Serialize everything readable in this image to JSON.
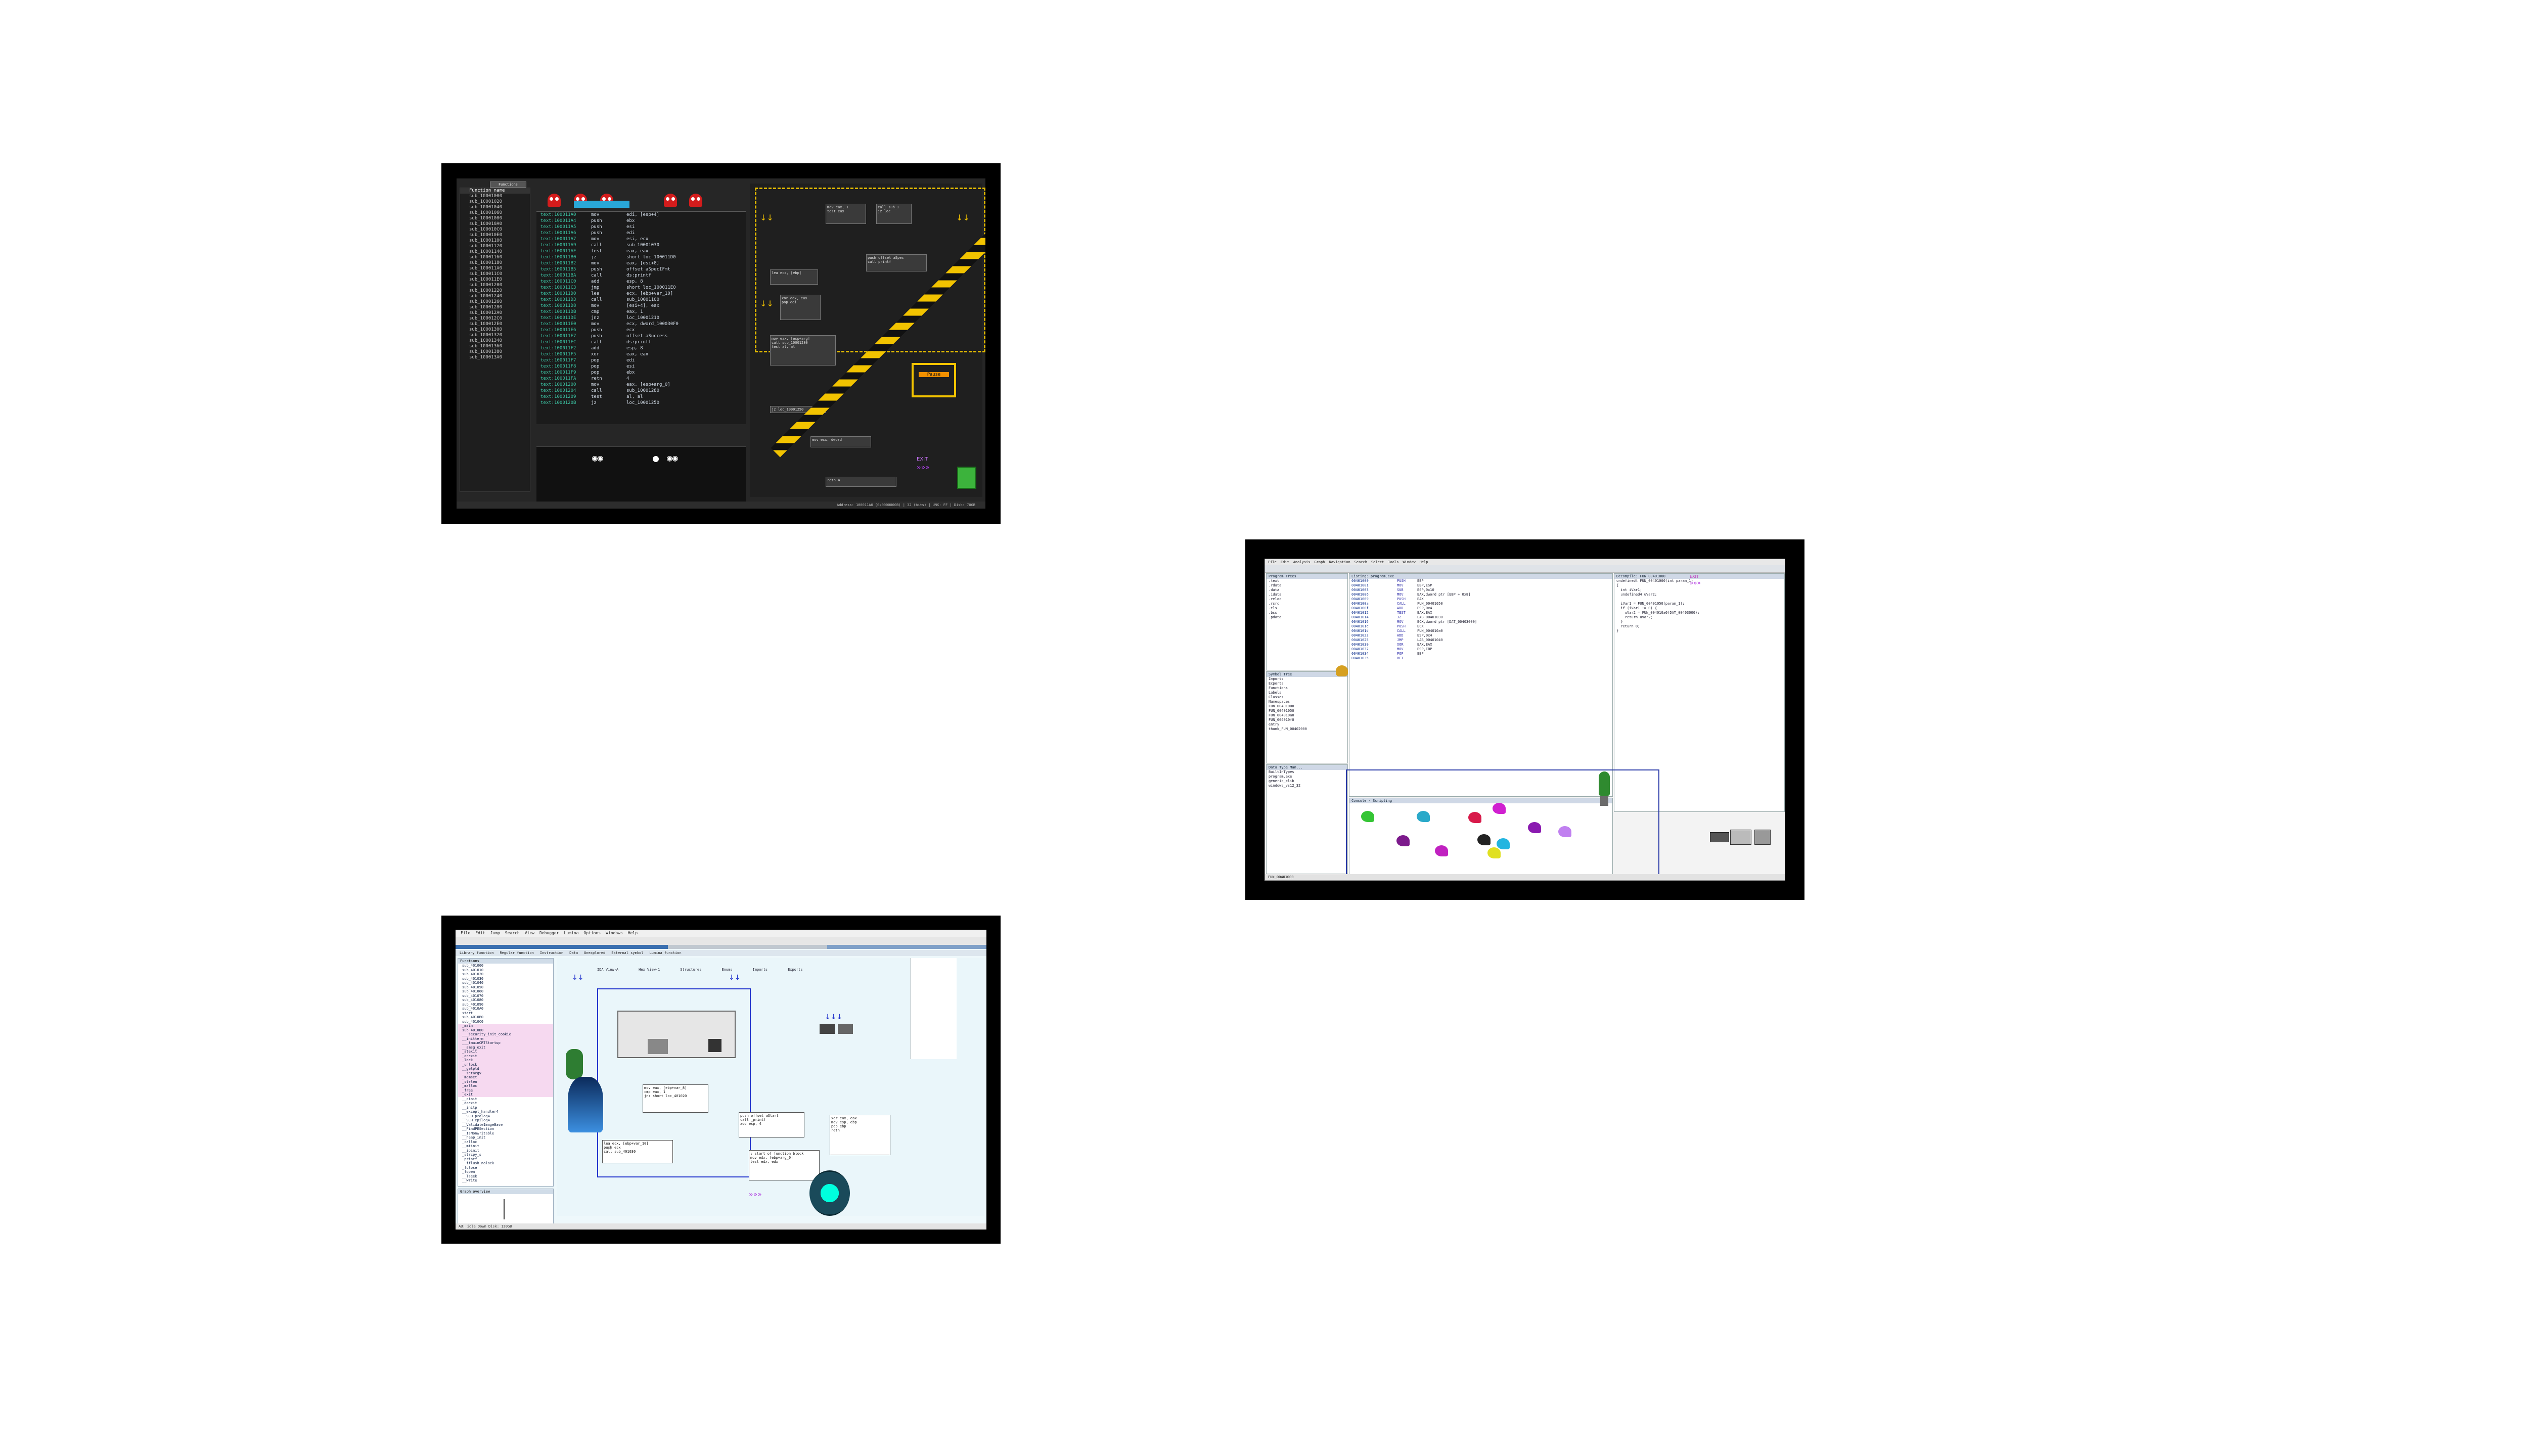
{
  "screens": [
    {
      "theme": "dark",
      "window_tab": "Functions",
      "functions_header": "Function name",
      "functions": [
        "sub_10001000",
        "sub_10001020",
        "sub_10001040",
        "sub_10001060",
        "sub_10001080",
        "sub_100010A0",
        "sub_100010C0",
        "sub_100010E0",
        "sub_10001100",
        "sub_10001120",
        "sub_10001140",
        "sub_10001160",
        "sub_10001180",
        "sub_100011A0",
        "sub_100011C0",
        "sub_100011E0",
        "sub_10001200",
        "sub_10001220",
        "sub_10001240",
        "sub_10001260",
        "sub_10001280",
        "sub_100012A0",
        "sub_100012C0",
        "sub_100012E0",
        "sub_10001300",
        "sub_10001320",
        "sub_10001340",
        "sub_10001360",
        "sub_10001380",
        "sub_100013A0"
      ],
      "code_lines": [
        {
          "addr": "text:100011A0",
          "mn": "mov",
          "op": "edi, [esp+4]"
        },
        {
          "addr": "text:100011A4",
          "mn": "push",
          "op": "ebx"
        },
        {
          "addr": "text:100011A5",
          "mn": "push",
          "op": "esi"
        },
        {
          "addr": "text:100011A6",
          "mn": "push",
          "op": "edi"
        },
        {
          "addr": "text:100011A7",
          "mn": "mov",
          "op": "esi, ecx"
        },
        {
          "addr": "text:100011A9",
          "mn": "call",
          "op": "sub_10001030"
        },
        {
          "addr": "text:100011AE",
          "mn": "test",
          "op": "eax, eax"
        },
        {
          "addr": "text:100011B0",
          "mn": "jz",
          "op": "short loc_100011D0"
        },
        {
          "addr": "text:100011B2",
          "mn": "mov",
          "op": "eax, [esi+8]"
        },
        {
          "addr": "text:100011B5",
          "mn": "push",
          "op": "offset aSpecIFmt"
        },
        {
          "addr": "text:100011BA",
          "mn": "call",
          "op": "ds:printf"
        },
        {
          "addr": "text:100011C0",
          "mn": "add",
          "op": "esp, 8"
        },
        {
          "addr": "text:100011C3",
          "mn": "jmp",
          "op": "short loc_100011E0"
        },
        {
          "addr": "text:100011D0",
          "mn": "lea",
          "op": "ecx, [ebp+var_10]"
        },
        {
          "addr": "text:100011D3",
          "mn": "call",
          "op": "sub_10001100"
        },
        {
          "addr": "text:100011D8",
          "mn": "mov",
          "op": "[esi+4], eax"
        },
        {
          "addr": "text:100011DB",
          "mn": "cmp",
          "op": "eax, 1"
        },
        {
          "addr": "text:100011DE",
          "mn": "jnz",
          "op": "loc_10001210"
        },
        {
          "addr": "text:100011E0",
          "mn": "mov",
          "op": "ecx, dword_100030F0"
        },
        {
          "addr": "text:100011E6",
          "mn": "push",
          "op": "ecx"
        },
        {
          "addr": "text:100011E7",
          "mn": "push",
          "op": "offset aSuccess"
        },
        {
          "addr": "text:100011EC",
          "mn": "call",
          "op": "ds:printf"
        },
        {
          "addr": "text:100011F2",
          "mn": "add",
          "op": "esp, 8"
        },
        {
          "addr": "text:100011F5",
          "mn": "xor",
          "op": "eax, eax"
        },
        {
          "addr": "text:100011F7",
          "mn": "pop",
          "op": "edi"
        },
        {
          "addr": "text:100011F8",
          "mn": "pop",
          "op": "esi"
        },
        {
          "addr": "text:100011F9",
          "mn": "pop",
          "op": "ebx"
        },
        {
          "addr": "text:100011FA",
          "mn": "retn",
          "op": "4"
        },
        {
          "addr": "text:10001200",
          "mn": "mov",
          "op": "eax, [esp+arg_0]"
        },
        {
          "addr": "text:10001204",
          "mn": "call",
          "op": "sub_10001280"
        },
        {
          "addr": "text:10001209",
          "mn": "test",
          "op": "al, al"
        },
        {
          "addr": "text:1000120B",
          "mn": "jz",
          "op": "loc_10001250"
        }
      ],
      "status": "Graph overview",
      "pause_label": "Pause",
      "exit_label": "EXIT",
      "bottom_status": "Address: 100011A0 (0x0000000B) | 32 (bits) | UNK: FF | Disk: 70GB"
    },
    {
      "theme": "ghidra",
      "menu": [
        "File",
        "Edit",
        "Analysis",
        "Graph",
        "Navigation",
        "Search",
        "Select",
        "Tools",
        "Window",
        "Help"
      ],
      "program_trees_title": "Program Trees",
      "program_tree_items": [
        ".text",
        ".rdata",
        ".data",
        ".idata",
        ".reloc",
        ".rsrc",
        ".tls",
        ".bss",
        ".pdata"
      ],
      "symbol_tree_title": "Symbol Tree",
      "symbol_items": [
        "Imports",
        "Exports",
        "Functions",
        "Labels",
        "Classes",
        "Namespaces",
        "FUN_00401000",
        "FUN_00401050",
        "FUN_004010a0",
        "FUN_004010f0",
        "entry",
        "thunk_FUN_00402000"
      ],
      "data_type_title": "Data Type Man...",
      "data_types": [
        "BuiltInTypes",
        "program.exe",
        "generic_clib",
        "windows_vs12_32"
      ],
      "listing_title": "Listing: program.exe",
      "listing_lines": [
        {
          "a": "00401000",
          "k": "PUSH",
          "o": "EBP"
        },
        {
          "a": "00401001",
          "k": "MOV",
          "o": "EBP,ESP"
        },
        {
          "a": "00401003",
          "k": "SUB",
          "o": "ESP,0x10"
        },
        {
          "a": "00401006",
          "k": "MOV",
          "o": "EAX,dword ptr [EBP + 0x8]"
        },
        {
          "a": "00401009",
          "k": "PUSH",
          "o": "EAX"
        },
        {
          "a": "0040100a",
          "k": "CALL",
          "o": "FUN_00401050"
        },
        {
          "a": "0040100f",
          "k": "ADD",
          "o": "ESP,0x4"
        },
        {
          "a": "00401012",
          "k": "TEST",
          "o": "EAX,EAX"
        },
        {
          "a": "00401014",
          "k": "JZ",
          "o": "LAB_00401030"
        },
        {
          "a": "00401016",
          "k": "MOV",
          "o": "ECX,dword ptr [DAT_00403000]"
        },
        {
          "a": "0040101c",
          "k": "PUSH",
          "o": "ECX"
        },
        {
          "a": "0040101d",
          "k": "CALL",
          "o": "FUN_004010a0"
        },
        {
          "a": "00401022",
          "k": "ADD",
          "o": "ESP,0x4"
        },
        {
          "a": "00401025",
          "k": "JMP",
          "o": "LAB_00401040"
        },
        {
          "a": "00401030",
          "k": "XOR",
          "o": "EAX,EAX"
        },
        {
          "a": "00401032",
          "k": "MOV",
          "o": "ESP,EBP"
        },
        {
          "a": "00401034",
          "k": "POP",
          "o": "EBP"
        },
        {
          "a": "00401035",
          "k": "RET",
          "": ""
        }
      ],
      "decompile_title": "Decompile: FUN_00401000",
      "decompile_lines": [
        "undefined4 FUN_00401000(int param_1)",
        "{",
        "  int iVar1;",
        "  undefined4 uVar2;",
        "",
        "  iVar1 = FUN_00401050(param_1);",
        "  if (iVar1 != 0) {",
        "    uVar2 = FUN_004010a0(DAT_00403000);",
        "    return uVar2;",
        "  }",
        "  return 0;",
        "}"
      ],
      "console_title": "Console - Scripting",
      "exit_label": "EXIT",
      "status_text": "FUN_00401000"
    },
    {
      "theme": "ida-light",
      "menu": [
        "File",
        "Edit",
        "Jump",
        "Search",
        "View",
        "Debugger",
        "Lumina",
        "Options",
        "Windows",
        "Help"
      ],
      "tabs": [
        "Library function",
        "Regular function",
        "Instruction",
        "Data",
        "Unexplored",
        "External symbol",
        "Lumina function"
      ],
      "view_tabs": [
        "IDA View-A",
        "Hex View-1",
        "Structures",
        "Enums",
        "Imports",
        "Exports"
      ],
      "functions_title": "Functions",
      "functions": [
        "sub_401000",
        "sub_401010",
        "sub_401020",
        "sub_401030",
        "sub_401040",
        "sub_401050",
        "sub_401060",
        "sub_401070",
        "sub_401080",
        "sub_401090",
        "sub_4010A0",
        "start",
        "sub_4010B0",
        "sub_4010C0",
        "_main",
        "sub_4010D0",
        "___security_init_cookie",
        "__initterm",
        "___tmainCRTStartup",
        "__amsg_exit",
        "_atexit",
        "_onexit",
        "_lock",
        "_unlock",
        "__getptd",
        "__setargv",
        "_memset",
        "_strlen",
        "_malloc",
        "_free",
        "_exit",
        "__cinit",
        "_doexit",
        "__initp",
        "__except_handler4",
        "__SEH_prolog4",
        "__SEH_epilog4",
        "__ValidateImageBase",
        "__FindPESection",
        "__IsNonwritable",
        "__heap_init",
        "_calloc",
        "__mtinit",
        "__ioinit",
        "_strcpy_s",
        "_printf",
        "__fflush_nolock",
        "_fclose",
        "_fopen",
        "__lseek",
        "__write"
      ],
      "graph_overview_title": "Graph overview",
      "nodes": [
        {
          "t": "loc_401000",
          "b": "mov eax, [ebp+var_8]\ncmp eax, 1\njnz short loc_401020"
        },
        {
          "t": "loc_401020",
          "b": "push offset aStart\ncall _printf\nadd esp, 4"
        },
        {
          "t": "loc_401040",
          "b": "xor eax, eax\nmov esp, ebp\npop ebp\nretn"
        },
        {
          "t": "loc_401060",
          "b": "lea ecx, [ebp+var_10]\npush ecx\ncall sub_401030"
        },
        {
          "t": "loc_401080",
          "b": "; start of function block\nmov edx, [ebp+arg_0]\ntest edx, edx"
        }
      ],
      "output_title": "Output",
      "status_text": "AU: idle   Down   Disk: 120GB"
    }
  ]
}
